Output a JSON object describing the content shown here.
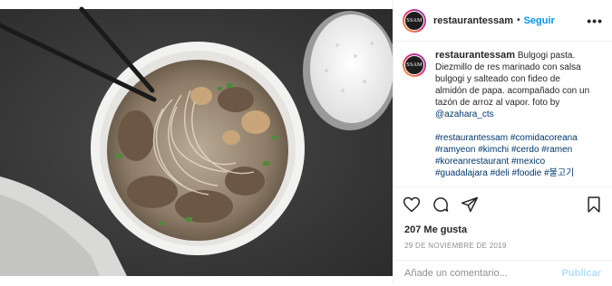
{
  "header": {
    "avatar_text": "SSAM",
    "username": "restaurantessam",
    "separator": "•",
    "follow_label": "Seguir",
    "more_label": "•••"
  },
  "caption": {
    "username": "restaurantessam",
    "text": "Bulgogi pasta. Diezmillo de res marinado con salsa bulgogi y salteado con fideo de almidón de papa. acompañado con un tazón de arroz al vapor. foto by",
    "mention": "@azahara_cts",
    "hashtags": [
      "#restaurantessam",
      "#comidacoreana",
      "#ramyeon",
      "#kimchi",
      "#cerdo",
      "#ramen",
      "#koreanrestaurant",
      "#mexico",
      "#guadalajara",
      "#deli",
      "#foodie",
      "#불고기"
    ]
  },
  "actions": {
    "icons": [
      "heart-icon",
      "comment-icon",
      "share-icon",
      "bookmark-icon"
    ]
  },
  "likes": "207 Me gusta",
  "date": "29 DE NOVIEMBRE DE 2019",
  "comment": {
    "placeholder": "Añade un comentario...",
    "publish_label": "Publicar"
  },
  "colors": {
    "accent": "#0095f6",
    "publish_disabled": "#b2dffc",
    "link": "#00376b",
    "muted": "#8e8e8e",
    "table_surface": "#3c3c3c"
  }
}
